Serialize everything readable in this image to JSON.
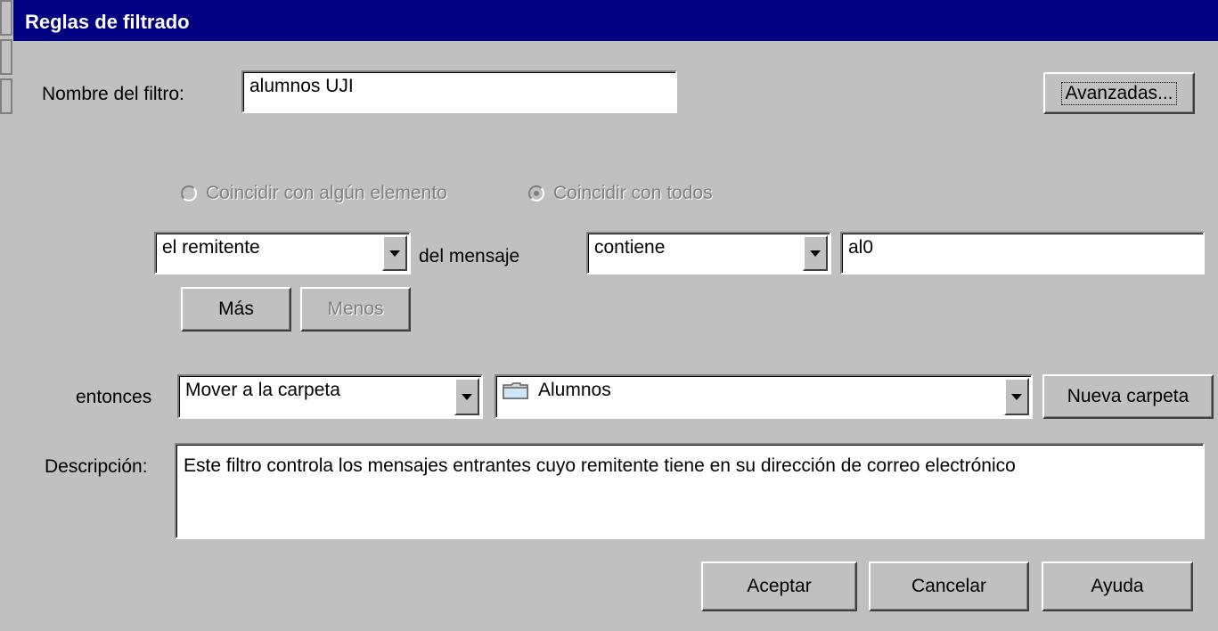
{
  "dialog": {
    "title": "Reglas de filtrado"
  },
  "filter_name": {
    "label": "Nombre del filtro:",
    "value": "alumnos UJI"
  },
  "advanced_button": {
    "label": "Avanzadas..."
  },
  "match": {
    "any_label": "Coincidir con algún elemento",
    "all_label": "Coincidir con todos",
    "selected": "all"
  },
  "rule": {
    "field": "el remitente",
    "connector": "del mensaje",
    "operator": "contiene",
    "value": "al0"
  },
  "more_button": {
    "label": "Más"
  },
  "less_button": {
    "label": "Menos"
  },
  "action": {
    "label": "entonces",
    "type": "Mover a la carpeta",
    "folder_icon": "folder-icon",
    "folder": "Alumnos",
    "new_folder_label": "Nueva carpeta"
  },
  "description": {
    "label": "Descripción:",
    "text": "Este filtro controla los mensajes entrantes cuyo remitente tiene en su dirección de correo electrónico"
  },
  "footer": {
    "ok": "Aceptar",
    "cancel": "Cancelar",
    "help": "Ayuda"
  },
  "colors": {
    "titlebar": "#000080",
    "face": "#c0c0c0",
    "disabled_text": "#808080"
  }
}
